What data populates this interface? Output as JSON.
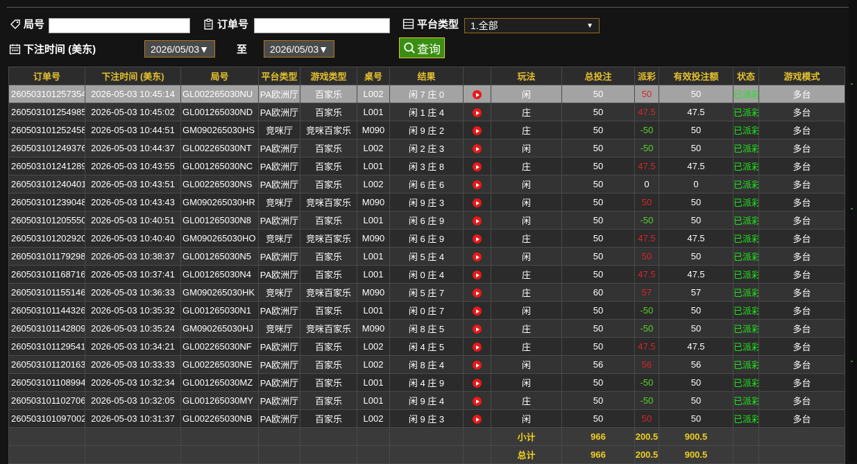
{
  "filters": {
    "round_label": "局号",
    "round_value": "",
    "order_label": "订单号",
    "order_value": "",
    "platform_label": "平台类型",
    "platform_value": "1.全部",
    "time_label": "下注时间 (美东)",
    "date_from": "2026/05/03▼",
    "to_label": "至",
    "date_to": "2026/05/03▼",
    "query_label": "查询"
  },
  "table": {
    "headers": [
      "订单号",
      "下注时间 (美东)",
      "局号",
      "平台类型",
      "游戏类型",
      "桌号",
      "结果",
      "",
      "玩法",
      "总投注",
      "派彩",
      "有效投注额",
      "状态",
      "游戏模式"
    ],
    "rows": [
      [
        "260503101257354",
        "2026-05-03 10:45:14",
        "GL002265030NU",
        "PA欧洲厅",
        "百家乐",
        "L002",
        "闲 7 庄 0",
        "闲",
        "50",
        "50",
        "50",
        "已派彩",
        "多台"
      ],
      [
        "260503101254985",
        "2026-05-03 10:45:02",
        "GL001265030ND",
        "PA欧洲厅",
        "百家乐",
        "L001",
        "闲 1 庄 4",
        "庄",
        "50",
        "47.5",
        "47.5",
        "已派彩",
        "多台"
      ],
      [
        "260503101252458",
        "2026-05-03 10:44:51",
        "GM090265030HS",
        "竞咪厅",
        "竞咪百家乐",
        "M090",
        "闲 9 庄 2",
        "庄",
        "50",
        "-50",
        "50",
        "已派彩",
        "多台"
      ],
      [
        "260503101249376",
        "2026-05-03 10:44:37",
        "GL002265030NT",
        "PA欧洲厅",
        "百家乐",
        "L002",
        "闲 2 庄 3",
        "闲",
        "50",
        "-50",
        "50",
        "已派彩",
        "多台"
      ],
      [
        "260503101241289",
        "2026-05-03 10:43:55",
        "GL001265030NC",
        "PA欧洲厅",
        "百家乐",
        "L001",
        "闲 3 庄 8",
        "庄",
        "50",
        "47.5",
        "47.5",
        "已派彩",
        "多台"
      ],
      [
        "260503101240401",
        "2026-05-03 10:43:51",
        "GL002265030NS",
        "PA欧洲厅",
        "百家乐",
        "L002",
        "闲 6 庄 6",
        "闲",
        "50",
        "0",
        "0",
        "已派彩",
        "多台"
      ],
      [
        "260503101239048",
        "2026-05-03 10:43:43",
        "GM090265030HR",
        "竞咪厅",
        "竞咪百家乐",
        "M090",
        "闲 9 庄 3",
        "闲",
        "50",
        "50",
        "50",
        "已派彩",
        "多台"
      ],
      [
        "260503101205550",
        "2026-05-03 10:40:51",
        "GL001265030N8",
        "PA欧洲厅",
        "百家乐",
        "L001",
        "闲 6 庄 9",
        "闲",
        "50",
        "-50",
        "50",
        "已派彩",
        "多台"
      ],
      [
        "260503101202920",
        "2026-05-03 10:40:40",
        "GM090265030HO",
        "竞咪厅",
        "竞咪百家乐",
        "M090",
        "闲 6 庄 9",
        "庄",
        "50",
        "47.5",
        "47.5",
        "已派彩",
        "多台"
      ],
      [
        "260503101179298",
        "2026-05-03 10:38:37",
        "GL001265030N5",
        "PA欧洲厅",
        "百家乐",
        "L001",
        "闲 5 庄 4",
        "闲",
        "50",
        "50",
        "50",
        "已派彩",
        "多台"
      ],
      [
        "260503101168716",
        "2026-05-03 10:37:41",
        "GL001265030N4",
        "PA欧洲厅",
        "百家乐",
        "L001",
        "闲 0 庄 4",
        "庄",
        "50",
        "47.5",
        "47.5",
        "已派彩",
        "多台"
      ],
      [
        "260503101155146",
        "2026-05-03 10:36:33",
        "GM090265030HK",
        "竞咪厅",
        "竞咪百家乐",
        "M090",
        "闲 5 庄 7",
        "庄",
        "60",
        "57",
        "57",
        "已派彩",
        "多台"
      ],
      [
        "260503101144326",
        "2026-05-03 10:35:32",
        "GL001265030N1",
        "PA欧洲厅",
        "百家乐",
        "L001",
        "闲 0 庄 7",
        "闲",
        "50",
        "-50",
        "50",
        "已派彩",
        "多台"
      ],
      [
        "260503101142809",
        "2026-05-03 10:35:24",
        "GM090265030HJ",
        "竞咪厅",
        "竞咪百家乐",
        "M090",
        "闲 8 庄 5",
        "庄",
        "50",
        "-50",
        "50",
        "已派彩",
        "多台"
      ],
      [
        "260503101129541",
        "2026-05-03 10:34:21",
        "GL002265030NF",
        "PA欧洲厅",
        "百家乐",
        "L002",
        "闲 4 庄 5",
        "庄",
        "50",
        "47.5",
        "47.5",
        "已派彩",
        "多台"
      ],
      [
        "260503101120163",
        "2026-05-03 10:33:33",
        "GL002265030NE",
        "PA欧洲厅",
        "百家乐",
        "L002",
        "闲 8 庄 4",
        "闲",
        "56",
        "56",
        "56",
        "已派彩",
        "多台"
      ],
      [
        "260503101108994",
        "2026-05-03 10:32:34",
        "GL001265030MZ",
        "PA欧洲厅",
        "百家乐",
        "L001",
        "闲 4 庄 9",
        "闲",
        "50",
        "-50",
        "50",
        "已派彩",
        "多台"
      ],
      [
        "260503101102706",
        "2026-05-03 10:32:05",
        "GL001265030MY",
        "PA欧洲厅",
        "百家乐",
        "L001",
        "闲 9 庄 4",
        "庄",
        "50",
        "-50",
        "50",
        "已派彩",
        "多台"
      ],
      [
        "260503101097002",
        "2026-05-03 10:31:37",
        "GL002265030NB",
        "PA欧洲厅",
        "百家乐",
        "L002",
        "闲 9 庄 3",
        "闲",
        "50",
        "50",
        "50",
        "已派彩",
        "多台"
      ]
    ],
    "subtotal": {
      "label": "小计",
      "total_bet": "966",
      "payout": "200.5",
      "valid_bet": "900.5"
    },
    "total": {
      "label": "总计",
      "total_bet": "966",
      "payout": "200.5",
      "valid_bet": "900.5"
    },
    "play_icon": "play-video-icon",
    "selected_row": 0
  },
  "colors": {
    "header_text": "#e6c22e",
    "payout_win": "#d8252a",
    "payout_loss": "#5ad42a",
    "status_paid": "#21e51d",
    "query_button": "#3a8f12",
    "selected_row": "#a3a3a3"
  }
}
